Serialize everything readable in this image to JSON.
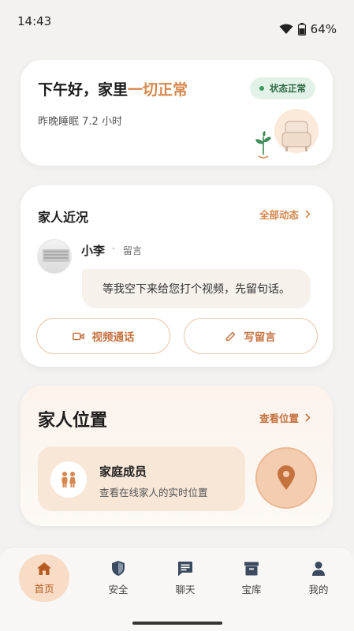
{
  "status_bar": {
    "time": "14:43",
    "battery": "64%"
  },
  "greeting": {
    "title_main": "下午好，家里",
    "title_accent": "一切正常",
    "subtitle": "昨晚睡眠 7.2 小时",
    "status_badge": "状态正常"
  },
  "family_updates": {
    "title": "家人近况",
    "all_link": "全部动态",
    "message": {
      "name": "小李",
      "separator": "·",
      "tag": "留言",
      "text": "等我空下来给您打个视频，先留句话。"
    },
    "video_call_label": "视频通话",
    "write_message_label": "写留言"
  },
  "location": {
    "title": "家人位置",
    "view_link": "查看位置",
    "member_title": "家庭成员",
    "member_subtitle": "查看在线家人的实时位置"
  },
  "bottom_nav": {
    "items": [
      {
        "label": "首页",
        "icon": "home-icon"
      },
      {
        "label": "安全",
        "icon": "shield-icon"
      },
      {
        "label": "聊天",
        "icon": "chat-icon"
      },
      {
        "label": "宝库",
        "icon": "archive-icon"
      },
      {
        "label": "我的",
        "icon": "person-icon"
      }
    ],
    "active_index": 0
  },
  "colors": {
    "accent": "#d6874d",
    "status_green": "#2f6a45",
    "active_nav_bg": "#f8dcc6"
  }
}
